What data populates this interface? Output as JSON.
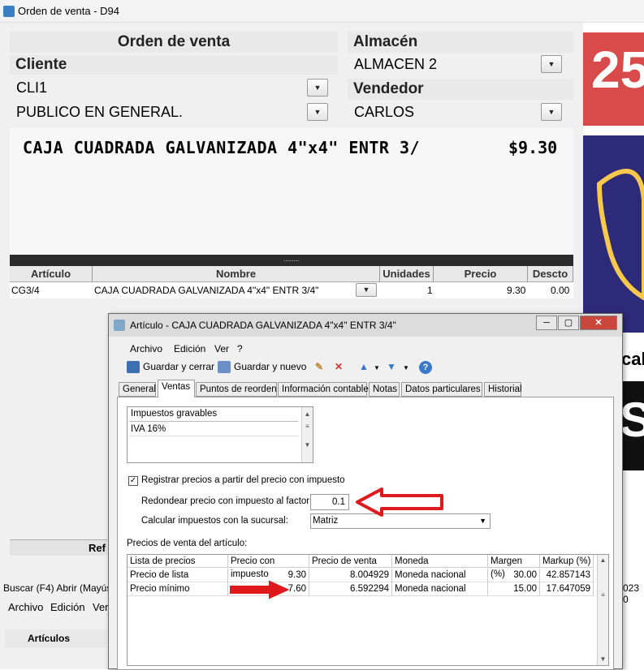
{
  "main_window": {
    "title": "Orden de venta - D94",
    "header_title": "Orden de venta",
    "cliente_label": "Cliente",
    "cliente_code": "CLI1",
    "cliente_name": "PUBLICO EN GENERAL.",
    "almacen_label": "Almacén",
    "almacen_value": "ALMACEN 2",
    "vendedor_label": "Vendedor",
    "vendedor_value": "CARLOS",
    "product_display_name": "CAJA CUADRADA GALVANIZADA 4\"x4\" ENTR 3/",
    "product_display_price": "$9.30",
    "splitter_dots": "........",
    "grid_columns": [
      "Artículo",
      "Nombre",
      "Unidades",
      "Precio",
      "Descto"
    ],
    "grid_row": {
      "articulo": "CG3/4",
      "nombre": "CAJA CUADRADA GALVANIZADA 4\"x4\" ENTR 3/4\"",
      "unidades": "1",
      "precio": "9.30",
      "descto": "0.00"
    },
    "partial_label": "Ref",
    "status_bar": "Buscar (F4)  Abrir (Mayús",
    "status_right": "023 0",
    "menu_bottom": [
      "Archivo",
      "Edición",
      "Ver"
    ],
    "nav_item": "Artículos",
    "right_panel_text": [
      "25",
      "cal",
      "S"
    ]
  },
  "dialog": {
    "title": "Artículo - CAJA CUADRADA GALVANIZADA 4\"x4\" ENTR 3/4\"",
    "menu": [
      "Archivo",
      "Edición",
      "Ver",
      "?"
    ],
    "toolbar": {
      "save_close": "Guardar y cerrar",
      "save_new": "Guardar y nuevo"
    },
    "tabs": [
      "General",
      "Ventas",
      "Puntos de reorden",
      "Información contable",
      "Notas",
      "Datos particulares",
      "Historial"
    ],
    "active_tab": "Ventas",
    "tax_list_header": "Impuestos gravables",
    "tax_list_items": [
      "IVA 16%"
    ],
    "checkbox_label": "Registrar precios a partir del precio con impuesto",
    "factor_label": "Redondear precio con impuesto al factor:",
    "factor_value": "0.1",
    "sucursal_label": "Calcular impuestos con la sucursal:",
    "sucursal_value": "Matriz",
    "prices_section_label": "Precios de venta del artículo:",
    "prices_columns": [
      "Lista de precios",
      "Precio con impuesto",
      "Precio de venta",
      "Moneda",
      "Margen (%)",
      "Markup (%)"
    ],
    "prices_rows": [
      {
        "lista": "Precio de lista",
        "con_impuesto": "9.30",
        "venta": "8.004929",
        "moneda": "Moneda nacional",
        "margen": "30.00",
        "markup": "42.857143"
      },
      {
        "lista": "Precio mínimo",
        "con_impuesto": "7.60",
        "venta": "6.592294",
        "moneda": "Moneda nacional",
        "margen": "15.00",
        "markup": "17.647059"
      }
    ]
  },
  "colors": {
    "annotation_arrow": "#e0191c",
    "banner_red": "#d94a4a",
    "banner_blue": "#2e2a7a"
  }
}
